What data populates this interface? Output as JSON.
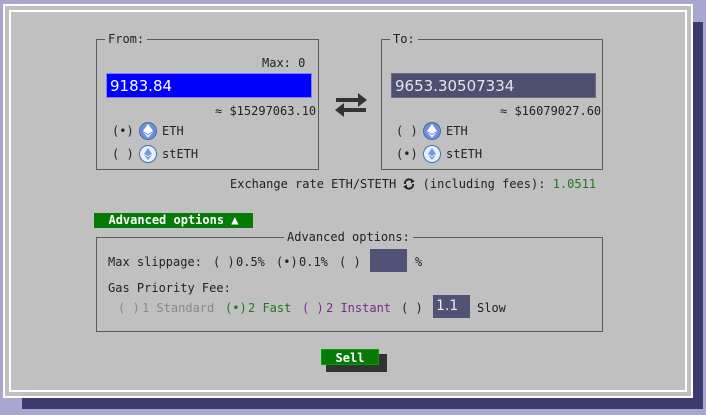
{
  "from": {
    "legend": "From:",
    "max_text": "Max: 0",
    "amount_value": "9183.84",
    "usd_text": "≈ $15297063.10",
    "options": [
      {
        "radio": "(•)",
        "label": "ETH",
        "icon": "eth-icon"
      },
      {
        "radio": "( )",
        "label": "stETH",
        "icon": "steth-icon"
      }
    ]
  },
  "to": {
    "legend": "To:",
    "amount_value": "9653.30507334",
    "usd_text": "≈ $16079027.60",
    "options": [
      {
        "radio": "( )",
        "label": "ETH",
        "icon": "eth-icon"
      },
      {
        "radio": "(•)",
        "label": "stETH",
        "icon": "steth-icon"
      }
    ]
  },
  "exchange": {
    "prefix": "Exchange rate ETH/STETH",
    "suffix": "(including fees):",
    "rate": "1.0511"
  },
  "advanced_button": "Advanced options ▲",
  "advanced": {
    "legend": "Advanced options:",
    "slippage_label": "Max slippage:",
    "slippage_options": [
      {
        "radio": "( )",
        "label": "0.5%"
      },
      {
        "radio": "(•)",
        "label": "0.1%"
      },
      {
        "radio": "( )",
        "label": ""
      }
    ],
    "slippage_custom_value": "",
    "slippage_unit": "%",
    "gas_label": "Gas Priority Fee:",
    "gas_options": [
      {
        "radio": "( )",
        "label": "1 Standard"
      },
      {
        "radio": "(•)",
        "label": "2 Fast"
      },
      {
        "radio": "( )",
        "label": "2 Instant"
      },
      {
        "radio": "( )",
        "label": ""
      }
    ],
    "gas_custom_value": "1.1",
    "gas_custom_suffix": "Slow"
  },
  "sell_label": "Sell",
  "colors": {
    "background": "#a9a6cf",
    "panel": "#c0c0c0",
    "accent_green": "#057b05",
    "from_field": "#0000ff",
    "to_field": "#4f4f72"
  }
}
